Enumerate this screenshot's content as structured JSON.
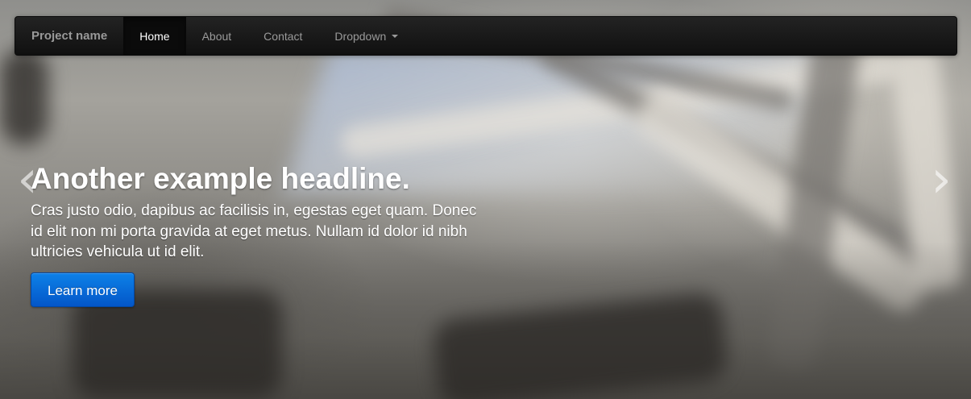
{
  "navbar": {
    "brand": "Project name",
    "items": [
      {
        "label": "Home",
        "active": true
      },
      {
        "label": "About",
        "active": false
      },
      {
        "label": "Contact",
        "active": false
      },
      {
        "label": "Dropdown",
        "active": false,
        "has_caret": true
      }
    ]
  },
  "slide": {
    "headline": "Another example headline.",
    "text": "Cras justo odio, dapibus ac facilisis in, egestas eget quam. Donec id elit non mi porta gravida at eget metus. Nullam id dolor id nibh ultricies vehicula ut id elit.",
    "button_label": "Learn more"
  },
  "carousel": {
    "prev_icon": "chevron-left-icon",
    "next_icon": "chevron-right-icon",
    "prev_glyph": "‹",
    "next_glyph": "›"
  },
  "colors": {
    "navbar": "#111111",
    "button_primary": "#0a6fdf",
    "text": "#ffffff"
  }
}
